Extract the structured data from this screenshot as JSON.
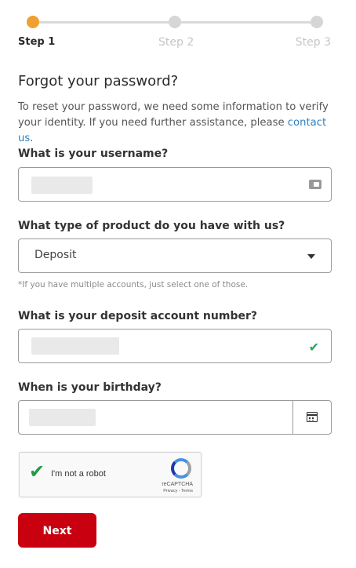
{
  "stepper": {
    "steps": [
      {
        "label": "Step 1",
        "state": "active"
      },
      {
        "label": "Step 2",
        "state": "inactive"
      },
      {
        "label": "Step 3",
        "state": "inactive"
      }
    ]
  },
  "page": {
    "title": "Forgot your password?",
    "intro_text": "To reset your password, we need some information to verify your identity. If you need further assistance, please ",
    "contact_link_label": "contact us",
    "intro_end": "."
  },
  "username": {
    "label": "What is your username?",
    "value": ""
  },
  "product": {
    "label": "What type of product do you have with us?",
    "selected": "Deposit",
    "hint": "*If you have multiple accounts, just select one of those."
  },
  "account": {
    "label": "What is your deposit account number?",
    "value": "",
    "status": "valid"
  },
  "birthday": {
    "label": "When is your birthday?",
    "value": ""
  },
  "captcha": {
    "label": "I'm not a robot",
    "brand": "reCAPTCHA",
    "links": "Privacy - Terms",
    "checked": true
  },
  "actions": {
    "next_label": "Next"
  },
  "colors": {
    "active_step": "#f0a030",
    "primary_button": "#c8000f",
    "link": "#2f80c0",
    "valid_check": "#25a35a"
  },
  "icons": {
    "username_field": "key-icon",
    "product_select": "chevron-down-icon",
    "account_field": "checkmark-icon",
    "birthday_field": "calendar-icon",
    "captcha": "recaptcha-logo-icon"
  }
}
